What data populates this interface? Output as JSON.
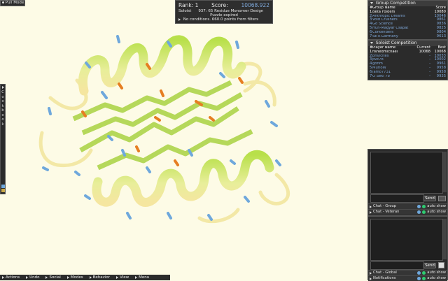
{
  "mode_button": {
    "label": "Pull Mode"
  },
  "top_panel": {
    "rank_label": "Rank: 1",
    "score_label": "Score:",
    "score_value": "10068.922",
    "role": "Soloist",
    "puzzle": "937: 65 Residue Monomer Design",
    "status": "Puzzle expired",
    "conditions": "No conditions. 660.0 points from filters"
  },
  "cookbook": {
    "letters": [
      "C",
      "o",
      "o",
      "k",
      "b",
      "o",
      "o",
      "k"
    ]
  },
  "group_competition": {
    "title": "Group Competition",
    "headers": {
      "num": "#",
      "name": "Group Name",
      "score": "Score"
    },
    "rows": [
      {
        "num": "1",
        "name": "Beta Folders",
        "score": "10080"
      },
      {
        "num": "2",
        "name": "Anthropic Dreams",
        "score": "10046"
      },
      {
        "num": "3",
        "name": "Void Crushers",
        "score": "9861"
      },
      {
        "num": "4",
        "name": "Go Science",
        "score": "9836"
      },
      {
        "num": "5",
        "name": "Hun-Magyar Csapat",
        "score": "9825"
      },
      {
        "num": "6",
        "name": "Contenders",
        "score": "9804"
      },
      {
        "num": "7",
        "name": "SETI.Germany",
        "score": "9613"
      }
    ]
  },
  "soloist_competition": {
    "title": "Soloist Competition",
    "headers": {
      "num": "#",
      "name": "Player Name",
      "current": "Current",
      "best": "Best"
    },
    "rows": [
      {
        "num": "1",
        "name": "fishedmichael",
        "current": "10068",
        "best": "10068"
      },
      {
        "num": "2",
        "name": "phi/icites",
        "current": "-",
        "best": "10033"
      },
      {
        "num": "3",
        "name": "pvc78",
        "current": "-",
        "best": "10002"
      },
      {
        "num": "4",
        "name": "gonm",
        "current": "-",
        "best": "9961"
      },
      {
        "num": "5",
        "name": "MurloW",
        "current": "-",
        "best": "9958"
      },
      {
        "num": "6",
        "name": "lamo7731",
        "current": "-",
        "best": "9958"
      },
      {
        "num": "7",
        "name": "O Seki 7o",
        "current": "-",
        "best": "9935"
      }
    ]
  },
  "chat_group": {
    "send_label": "Send",
    "tabs": [
      {
        "label": "Chat - Group",
        "auto": "auto show"
      },
      {
        "label": "Chat - Veteran",
        "auto": "auto show"
      }
    ]
  },
  "chat_global": {
    "send_label": "Send",
    "tabs": [
      {
        "label": "Chat - Global",
        "auto": "auto show"
      },
      {
        "label": "Notifications",
        "auto": "auto show"
      }
    ]
  },
  "bottom_menu": [
    "Actions",
    "Undo",
    "Social",
    "Modes",
    "Behavior",
    "View",
    "Menu"
  ],
  "colors": {
    "panel": "#2b2b2b",
    "background": "#fdfbe6",
    "helix": "#d8e88a",
    "sheet": "#c4e070",
    "sidechain_blue": "#6fa8dc",
    "sidechain_orange": "#e67e22"
  }
}
